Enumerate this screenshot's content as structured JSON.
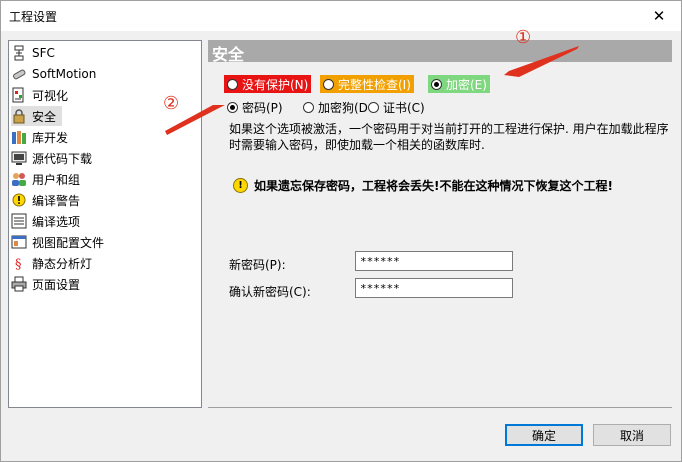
{
  "window": {
    "title": "工程设置",
    "close_glyph": "✕"
  },
  "nav": {
    "items": [
      {
        "label": "SFC",
        "icon": "sfc-icon"
      },
      {
        "label": "SoftMotion",
        "icon": "softmotion-icon"
      },
      {
        "label": "可视化",
        "icon": "visualization-icon"
      },
      {
        "label": "安全",
        "icon": "lock-icon",
        "selected": true
      },
      {
        "label": "库开发",
        "icon": "library-icon"
      },
      {
        "label": "源代码下载",
        "icon": "source-download-icon"
      },
      {
        "label": "用户和组",
        "icon": "users-icon"
      },
      {
        "label": "编译警告",
        "icon": "warning-icon"
      },
      {
        "label": "编译选项",
        "icon": "compile-options-icon"
      },
      {
        "label": "视图配置文件",
        "icon": "view-profile-icon"
      },
      {
        "label": "静态分析灯",
        "icon": "static-analysis-icon"
      },
      {
        "label": "页面设置",
        "icon": "printer-icon"
      }
    ]
  },
  "section": {
    "title": "安全"
  },
  "protection": {
    "none": "没有保护(N)",
    "integrity": "完整性检查(I)",
    "encrypt": "加密(E)",
    "colors": {
      "none": "#e81414",
      "integrity": "#f2a000",
      "encrypt": "#7fd87f"
    }
  },
  "encrypt_mode": {
    "password": "密码(P)",
    "dongle": "加密狗(D",
    "certificate": "证书(C)"
  },
  "description": "如果这个选项被激活，一个密码用于对当前打开的工程进行保护. 用户在加载此程序时需要输入密码，即使加载一个相关的函数库时.",
  "warning": "如果遗忘保存密码，工程将会丢失!不能在这种情况下恢复这个工程!",
  "fields": {
    "new_password_label": "新密码(P):",
    "new_password_value": "******",
    "confirm_password_label": "确认新密码(C):",
    "confirm_password_value": "******"
  },
  "buttons": {
    "ok": "确定",
    "cancel": "取消"
  },
  "annotations": {
    "one": "①",
    "two": "②"
  }
}
